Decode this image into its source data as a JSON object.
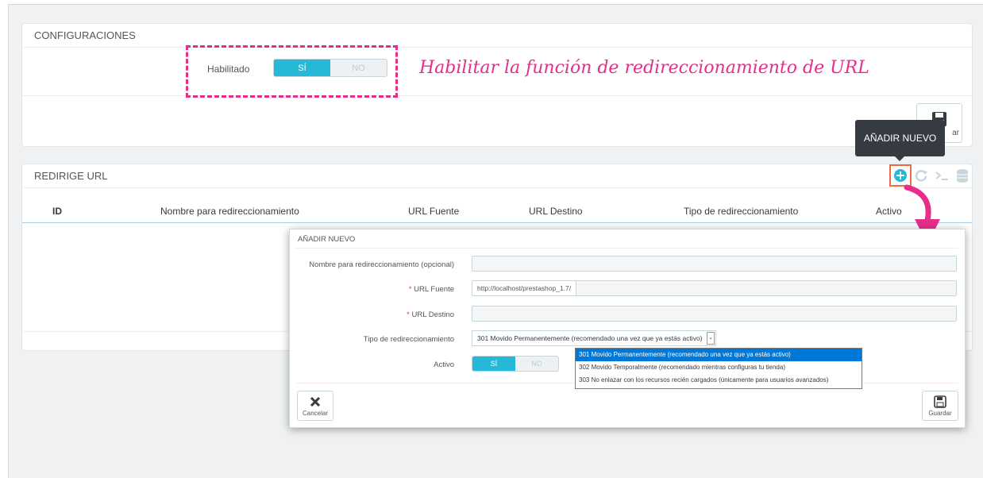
{
  "config": {
    "heading": "CONFIGURACIONES",
    "enabled_label": "Habilitado",
    "yes": "SÍ",
    "no": "NO",
    "save_label": "ar"
  },
  "annotation": "Habilitar la función de redireccionamiento de URL",
  "tooltip": "AÑADIR NUEVO",
  "redirect_panel": {
    "heading": "REDIRIGE URL",
    "columns": [
      "ID",
      "Nombre para redireccionamiento",
      "URL Fuente",
      "URL Destino",
      "Tipo de redireccionamiento",
      "Activo"
    ]
  },
  "modal": {
    "heading": "AÑADIR NUEVO",
    "name_label": "Nombre para redireccionamiento (opcional)",
    "source_label": "URL Fuente",
    "source_value": "http://localhost/prestashop_1.7/",
    "dest_label": "URL Destino",
    "type_label": "Tipo de redireccionamiento",
    "type_selected": "301 Movido Permanentemente (recomendado una vez que ya estás activo)",
    "type_options": [
      "301 Movido Permanentemente (recomendado una vez que ya estás activo)",
      "302 Movido Temporalmente (recomendado mientras configuras tu tienda)",
      "303 No enlazar con los recursos recién cargados (únicamente para usuarios avanzados)"
    ],
    "active_label": "Activo",
    "yes": "SÍ",
    "no": "NO",
    "cancel_label": "Cancelar",
    "save_label": "Guardar"
  },
  "colors": {
    "accent": "#25b9d7",
    "annotation": "#e62e8a",
    "highlight": "#0078d7"
  }
}
